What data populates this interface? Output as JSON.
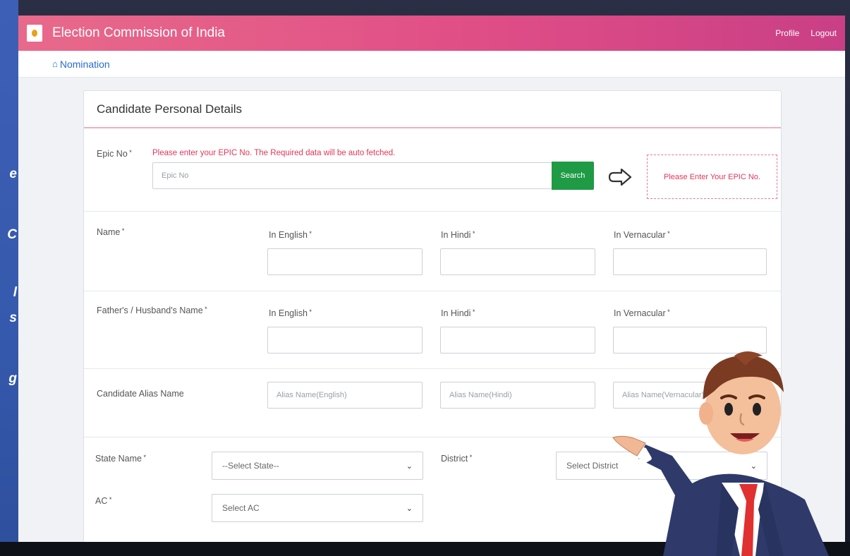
{
  "side_fragments": [
    "e",
    "C",
    "l",
    "s",
    "g"
  ],
  "header": {
    "title": "Election Commission of India",
    "links": [
      "Profile",
      "Logout"
    ]
  },
  "breadcrumb": {
    "label": "Nomination"
  },
  "card": {
    "title": "Candidate Personal Details"
  },
  "epic": {
    "label": "Epic No",
    "hint": "Please enter your EPIC No. The Required data will be auto fetched.",
    "placeholder": "Epic No",
    "search_label": "Search",
    "note": "Please Enter Your EPIC No."
  },
  "name_row": {
    "label": "Name",
    "cols": [
      "In English",
      "In Hindi",
      "In Vernacular"
    ]
  },
  "father_row": {
    "label": "Father's / Husband's Name",
    "cols": [
      "In English",
      "In Hindi",
      "In Vernacular"
    ]
  },
  "alias_row": {
    "label": "Candidate Alias Name",
    "placeholders": [
      "Alias Name(English)",
      "Alias Name(Hindi)",
      "Alias Name(Vernacular)"
    ]
  },
  "state": {
    "label": "State Name",
    "value": "--Select State--"
  },
  "district": {
    "label": "District",
    "value": "Select District"
  },
  "ac": {
    "label": "AC",
    "value": "Select AC"
  },
  "colors": {
    "header_start": "#e86a8b",
    "header_end": "#c93f86",
    "search": "#1f9a45",
    "hint": "#e2365a",
    "link": "#2b6ad1"
  }
}
